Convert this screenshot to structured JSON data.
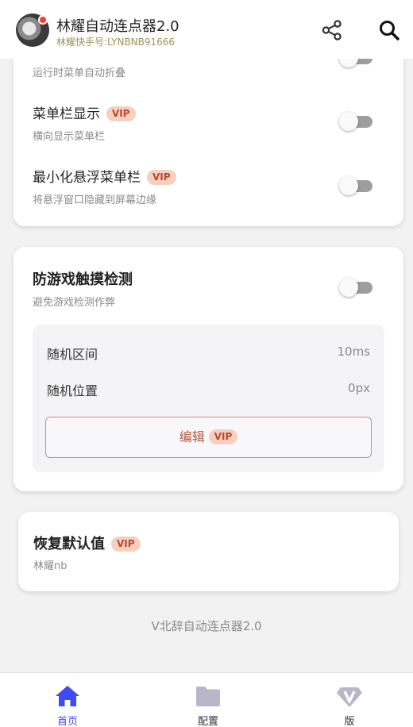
{
  "header": {
    "title": "林耀自动连点器2.0",
    "subtitle": "林耀快手号:LYNBNB91666"
  },
  "menu_card": {
    "partial_row_sub": "运行时菜单自动折叠",
    "rows": [
      {
        "title": "菜单栏显示",
        "vip": "VIP",
        "sub": "横向显示菜单栏",
        "toggle_on": false
      },
      {
        "title": "最小化悬浮菜单栏",
        "vip": "VIP",
        "sub": "将悬浮窗口隐藏到屏幕边缘",
        "toggle_on": false
      }
    ]
  },
  "anti_detect_card": {
    "title": "防游戏触摸检测",
    "sub": "避免游戏检测作弊",
    "toggle_on": false,
    "settings": [
      {
        "label": "随机区间",
        "value": "10ms"
      },
      {
        "label": "随机位置",
        "value": "0px"
      }
    ],
    "edit_label": "编辑",
    "edit_vip": "VIP"
  },
  "reset_card": {
    "title": "恢复默认值",
    "vip": "VIP",
    "sub": "林耀nb"
  },
  "footer_text": "V北辞自动连点器2.0",
  "bottom_nav": [
    {
      "label": "首页",
      "icon": "home-icon",
      "active": true
    },
    {
      "label": "配置",
      "icon": "folder-icon",
      "active": false
    },
    {
      "label": "版",
      "icon": "v-diamond-icon",
      "active": false
    }
  ],
  "colors": {
    "active": "#3d4cf5",
    "inactive": "#b8b6c8",
    "vip_bg": "#f6cfc0",
    "vip_text": "#b54a2c"
  }
}
